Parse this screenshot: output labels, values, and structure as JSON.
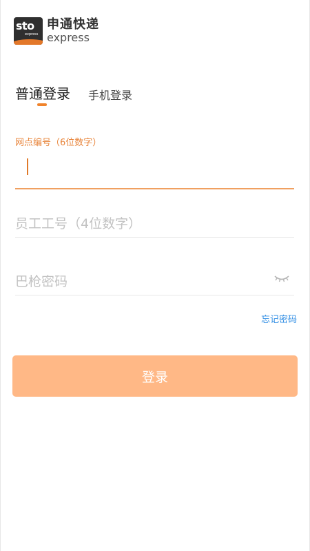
{
  "brand": {
    "logo_mark": "sto",
    "logo_mark_sub": "express",
    "name_cn": "申通快递",
    "name_en": "express",
    "accent": "#f0832b"
  },
  "tabs": [
    {
      "label": "普通登录",
      "active": true
    },
    {
      "label": "手机登录",
      "active": false
    }
  ],
  "form": {
    "outlet_id": {
      "label": "网点编号（6位数字）",
      "value": "",
      "placeholder": ""
    },
    "employee_id": {
      "placeholder": "员工工号（4位数字）",
      "value": ""
    },
    "password": {
      "placeholder": "巴枪密码",
      "value": "",
      "toggle_icon": "eye-closed-icon"
    }
  },
  "forgot_label": "忘记密码",
  "login_label": "登录",
  "colors": {
    "button": "#ffb886",
    "link": "#2f8de4",
    "label": "#e8843a"
  }
}
